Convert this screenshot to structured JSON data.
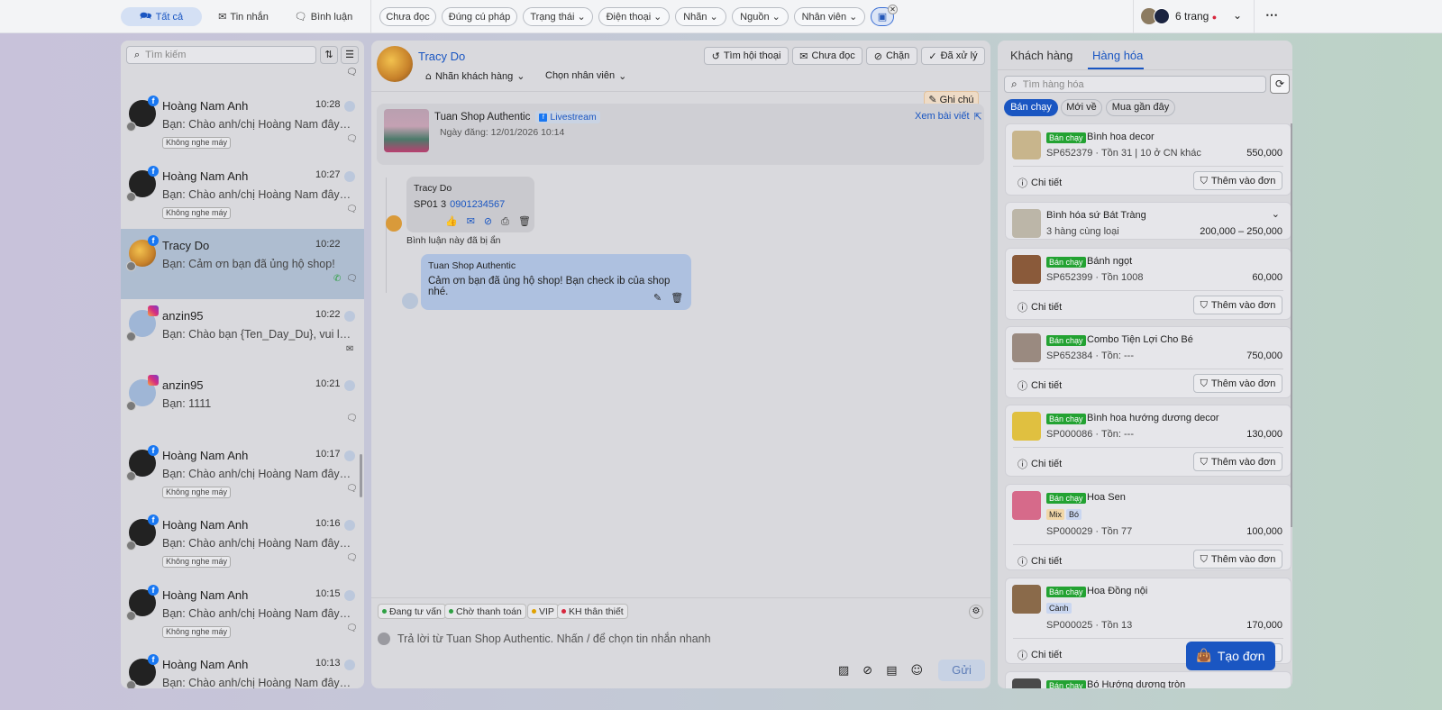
{
  "topbar": {
    "tabs": [
      {
        "label": "Tất cả",
        "icon": "chat-bubbles-icon",
        "active": true
      },
      {
        "label": "Tin nhắn",
        "icon": "mail-icon"
      },
      {
        "label": "Bình luận",
        "icon": "comment-icon"
      }
    ],
    "filters": [
      "Chưa đọc",
      "Đúng cú pháp",
      "Trạng thái",
      "Điện thoại",
      "Nhãn",
      "Nguồn",
      "Nhân viên"
    ],
    "pages_label": "6 trang",
    "accent": "#1a56c2"
  },
  "sidebar": {
    "search_placeholder": "Tìm kiếm",
    "conversations": [
      {
        "name": "Hoàng Nam Anh",
        "time": "10:28",
        "message": "Bạn: Chào anh/chị Hoàng Nam đây là...",
        "tag": "Không nghe máy",
        "source": "facebook"
      },
      {
        "name": "Hoàng Nam Anh",
        "time": "10:27",
        "message": "Bạn: Chào anh/chị Hoàng Nam đây là...",
        "tag": "Không nghe máy",
        "source": "facebook"
      },
      {
        "name": "Tracy Do",
        "time": "10:22",
        "message": "Bạn: Cảm ơn bạn đã ủng hộ shop!",
        "tag": "",
        "source": "facebook",
        "selected": true
      },
      {
        "name": "anzin95",
        "time": "10:22",
        "message": "Bạn: Chào bạn {Ten_Day_Du}, vui lòn...",
        "tag": "",
        "source": "instagram"
      },
      {
        "name": "anzin95",
        "time": "10:21",
        "message": "Bạn: 1111",
        "tag": "",
        "source": "instagram"
      },
      {
        "name": "Hoàng Nam Anh",
        "time": "10:17",
        "message": "Bạn: Chào anh/chị Hoàng Nam đây là...",
        "tag": "Không nghe máy",
        "source": "facebook"
      },
      {
        "name": "Hoàng Nam Anh",
        "time": "10:16",
        "message": "Bạn: Chào anh/chị Hoàng Nam đây là...",
        "tag": "Không nghe máy",
        "source": "facebook"
      },
      {
        "name": "Hoàng Nam Anh",
        "time": "10:15",
        "message": "Bạn: Chào anh/chị Hoàng Nam đây là...",
        "tag": "Không nghe máy",
        "source": "facebook"
      },
      {
        "name": "Hoàng Nam Anh",
        "time": "10:13",
        "message": "Bạn: Chào anh/chị Hoàng Nam đây là...",
        "tag": "",
        "source": "facebook"
      }
    ]
  },
  "chat": {
    "contact_name": "Tracy Do",
    "label_customer": "Nhãn khách hàng",
    "choose_staff": "Chọn nhân viên",
    "actions": [
      "Tìm hội thoại",
      "Chưa đọc",
      "Chặn",
      "Đã xử lý"
    ],
    "note_label": "Ghi chú",
    "post": {
      "shop": "Tuan Shop Authentic",
      "badge": "Livestream",
      "date": "Ngày đăng: 12/01/2026 10:14",
      "view_link": "Xem bài viết"
    },
    "comment": {
      "author": "Tracy Do",
      "text_prefix": "SP01 3",
      "phone": "0901234567",
      "hidden_note": "Bình luận này đã bị ẩn"
    },
    "reply": {
      "author": "Tuan Shop Authentic",
      "text": "Cảm ơn bạn đã ủng hộ shop! Bạn check ib của shop nhé."
    },
    "status_tags": [
      {
        "label": "Đang tư vấn",
        "color": "#2ea043"
      },
      {
        "label": "Chờ thanh toán",
        "color": "#2ea043"
      },
      {
        "label": "VIP",
        "color": "#e0a100"
      },
      {
        "label": "KH thân thiết",
        "color": "#d7263d"
      }
    ],
    "composer_placeholder": "Trả lời từ Tuan Shop Authentic. Nhấn / để chọn tin nhắn nhanh",
    "send_label": "Gửi"
  },
  "products": {
    "tabs": [
      "Khách hàng",
      "Hàng hóa"
    ],
    "active_tab": "Hàng hóa",
    "search_placeholder": "Tìm hàng hóa",
    "filters": [
      "Bán chạy",
      "Mới về",
      "Mua gần đây"
    ],
    "best_label": "Bán chạy",
    "detail_label": "Chi tiết",
    "add_label": "Thêm vào đơn",
    "items": [
      {
        "name": "Bình hoa decor",
        "sub": "SP652379 · Tồn 31 | 10 ở CN khác",
        "price": "550,000",
        "best": true
      },
      {
        "name": "Bình hóa sứ Bát Tràng",
        "sub": "3 hàng cùng loại",
        "price": "200,000 – 250,000",
        "best": false
      },
      {
        "name": "Bánh ngọt",
        "sub": "SP652399 · Tồn 1008",
        "price": "60,000",
        "best": true
      },
      {
        "name": "Combo Tiện Lợi Cho Bé",
        "sub": "SP652384 · Tồn: ---",
        "price": "750,000",
        "best": true
      },
      {
        "name": "Bình hoa hướng dương decor",
        "sub": "SP000086 · Tồn: ---",
        "price": "130,000",
        "best": true
      },
      {
        "name": "Hoa Sen",
        "chips": [
          "Mix",
          "Bó"
        ],
        "sub": "SP000029 · Tồn 77",
        "price": "100,000",
        "best": true
      },
      {
        "name": "Hoa Đồng nội",
        "chips": [
          "Cành"
        ],
        "sub": "SP000025 · Tồn 13",
        "price": "170,000",
        "best": true
      },
      {
        "name": "Bó Hướng dương tròn",
        "sub": "",
        "price": "",
        "best": true
      }
    ],
    "create_order": "Tạo đơn"
  }
}
